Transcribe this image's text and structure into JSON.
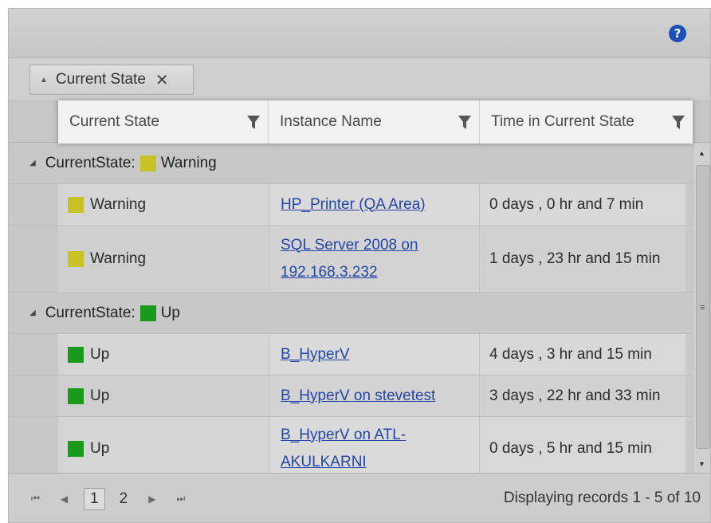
{
  "toolbar": {
    "help_icon": "?"
  },
  "grouping": {
    "chip_label": "Current State",
    "remove_icon": "✕",
    "sort_icon": "▲"
  },
  "columns": [
    {
      "label": "Current State",
      "filter_icon": "funnel-icon"
    },
    {
      "label": "Instance Name",
      "filter_icon": "funnel-icon"
    },
    {
      "label": "Time in Current State",
      "filter_icon": "funnel-icon"
    }
  ],
  "groups": [
    {
      "label": "CurrentState:",
      "value": "Warning",
      "color": "#c8c224",
      "rows": [
        {
          "state": "Warning",
          "instance_line1": "HP_Printer (QA Area)",
          "instance_line2": "",
          "time": "0 days , 0 hr and 7 min"
        },
        {
          "state": "Warning",
          "instance_line1": "SQL Server 2008 on",
          "instance_line2": "192.168.3.232",
          "time": "1 days , 23 hr and 15 min"
        }
      ]
    },
    {
      "label": "CurrentState:",
      "value": "Up",
      "color": "#1a9a1a",
      "rows": [
        {
          "state": "Up",
          "instance_line1": "B_HyperV",
          "instance_line2": "",
          "time": "4 days , 3 hr and 15 min"
        },
        {
          "state": "Up",
          "instance_line1": "B_HyperV on stevetest",
          "instance_line2": "",
          "time": "3 days , 22 hr and 33 min"
        },
        {
          "state": "Up",
          "instance_line1": "B_HyperV on ATL-",
          "instance_line2": "AKULKARNI",
          "time": "0 days , 5 hr and 15 min"
        }
      ]
    }
  ],
  "pager": {
    "first_icon": "⏮",
    "prev_icon": "◀",
    "pages": [
      "1",
      "2"
    ],
    "current_page": "1",
    "next_icon": "▶",
    "last_icon": "⏭",
    "status": "Displaying records 1 - 5 of 10"
  },
  "scrollbar": {
    "grip": "≡"
  }
}
